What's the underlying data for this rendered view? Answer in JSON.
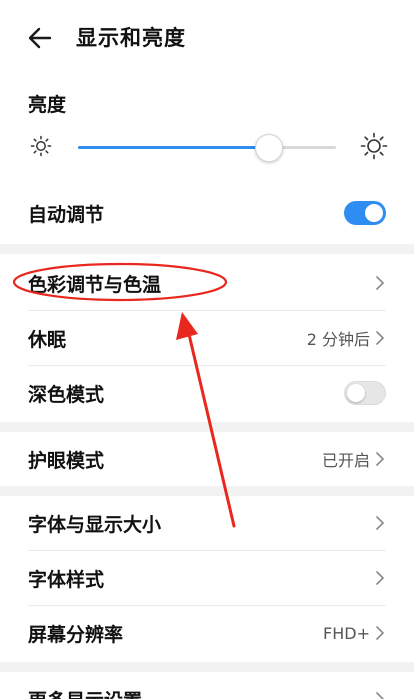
{
  "header": {
    "title": "显示和亮度",
    "back_icon": "arrow-left-icon"
  },
  "brightness": {
    "label": "亮度",
    "level": 0.74,
    "accent_color": "#2f8cf0"
  },
  "auto_adjust": {
    "label": "自动调节",
    "enabled": true
  },
  "items": [
    {
      "label": "色彩调节与色温",
      "value": ""
    },
    {
      "label": "休眠",
      "value": "2 分钟后"
    },
    {
      "label": "深色模式",
      "toggle": false
    },
    {
      "label": "护眼模式",
      "value": "已开启"
    },
    {
      "label": "字体与显示大小",
      "value": ""
    },
    {
      "label": "字体样式",
      "value": ""
    },
    {
      "label": "屏幕分辨率",
      "value": "FHD+"
    },
    {
      "label": "更多显示设置",
      "value": ""
    }
  ],
  "annotation": {
    "color": "#e8281f"
  }
}
